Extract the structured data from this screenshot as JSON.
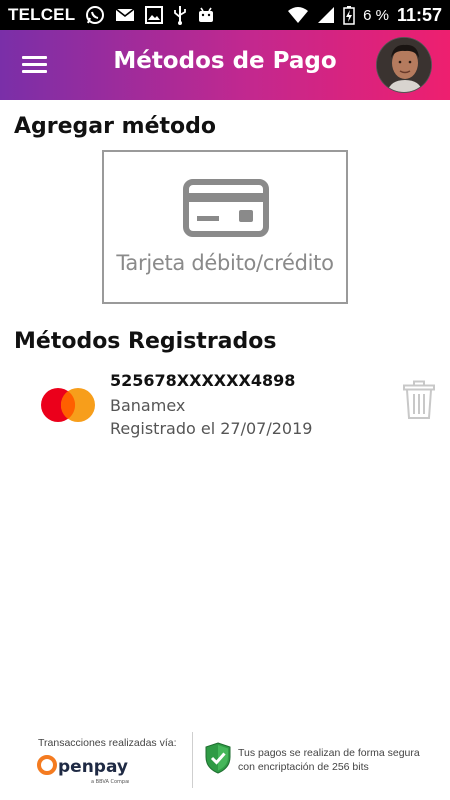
{
  "status_bar": {
    "carrier": "TELCEL",
    "battery_percent": "6 %",
    "time": "11:57",
    "icons": [
      "whatsapp-icon",
      "mail-icon",
      "image-icon",
      "usb-icon",
      "android-icon",
      "wifi-icon",
      "signal-icon",
      "battery-charging-icon"
    ]
  },
  "app_bar": {
    "title": "Métodos de Pago",
    "gradient_start": "#7a2fa8",
    "gradient_end": "#ee1f6f"
  },
  "add_method": {
    "heading": "Agregar método",
    "card_option_label": "Tarjeta débito/crédito",
    "icon": "credit-card-icon"
  },
  "registered": {
    "heading": "Métodos Registrados",
    "methods": [
      {
        "number": "525678XXXXXX4898",
        "bank": "Banamex",
        "registered": "Registrado el 27/07/2019",
        "brand_icon": "mastercard-logo",
        "action_icon": "trash-icon"
      }
    ]
  },
  "footer": {
    "via_label": "Transacciones realizadas vía:",
    "brand_name": "Openpay",
    "brand_tagline": "a BBVA Company",
    "secure_text": "Tus pagos se realizan de forma segura con encriptación de 256 bits"
  }
}
